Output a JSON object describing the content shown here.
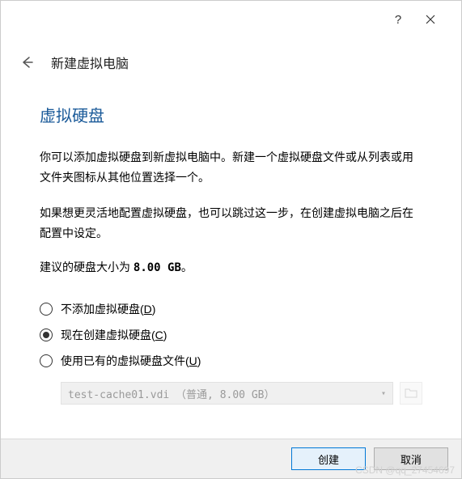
{
  "window": {
    "help": "?",
    "close": "×"
  },
  "header": {
    "title": "新建虚拟电脑"
  },
  "section": {
    "title": "虚拟硬盘",
    "para1": "你可以添加虚拟硬盘到新虚拟电脑中。新建一个虚拟硬盘文件或从列表或用文件夹图标从其他位置选择一个。",
    "para2": "如果想更灵活地配置虚拟硬盘，也可以跳过这一步，在创建虚拟电脑之后在配置中设定。",
    "rec_prefix": "建议的硬盘大小为 ",
    "rec_size": "8.00 GB",
    "rec_suffix": "。"
  },
  "options": {
    "none": {
      "label": "不添加虚拟硬盘(",
      "accel": "D",
      "suffix": ")"
    },
    "create": {
      "label": "现在创建虚拟硬盘(",
      "accel": "C",
      "suffix": ")",
      "selected": true
    },
    "existing": {
      "label": "使用已有的虚拟硬盘文件(",
      "accel": "U",
      "suffix": ")"
    }
  },
  "file_select": {
    "value": "test-cache01.vdi （普通, 8.00 GB）",
    "disabled": true
  },
  "buttons": {
    "create": "创建",
    "cancel": "取消"
  },
  "watermark": "CSDN @qq_27454697"
}
